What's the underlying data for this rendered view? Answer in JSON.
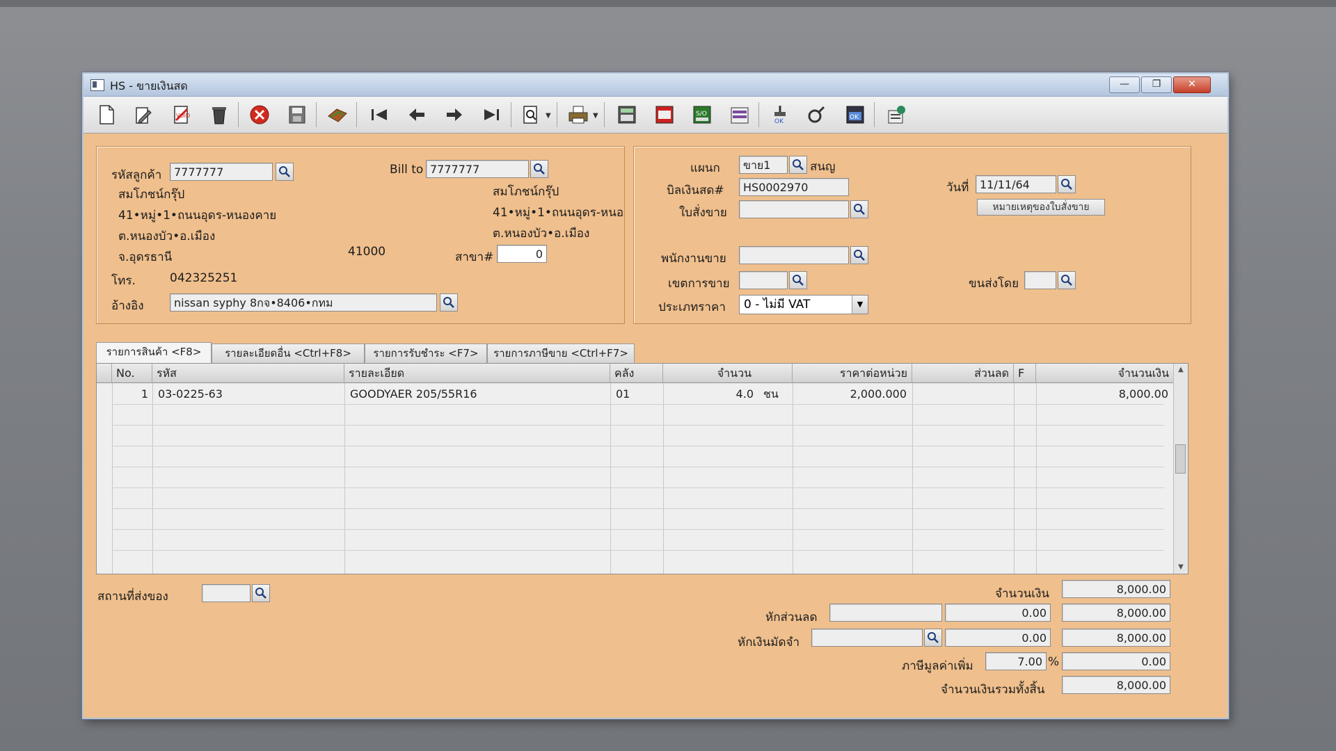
{
  "window": {
    "title": "HS - ขายเงินสด",
    "min_label": "—",
    "max_label": "❐",
    "close_label": "✕"
  },
  "toolbar": {
    "items": [
      "new-doc",
      "edit",
      "void",
      "delete",
      "cancel",
      "save",
      "copy",
      "first",
      "prev",
      "next",
      "last",
      "preview",
      "print",
      "calc-1",
      "calc-2",
      "so-yes",
      "report",
      "approve",
      "lock",
      "ok",
      "export"
    ]
  },
  "customer": {
    "code_label": "รหัสลูกค้า",
    "code_value": "7777777",
    "name": "สมโภชน์กรุ๊ป",
    "address1": "41•หมู่•1•ถนนอุดร-หนองคาย",
    "address2": "ต.หนองบัว•อ.เมือง",
    "province": "จ.อุดรธานี",
    "postcode": "41000",
    "phone_label": "โทร.",
    "phone_value": "042325251",
    "ref_label": "อ้างอิง",
    "ref_value": "nissan syphy 8กจ•8406•กทม"
  },
  "billto": {
    "label": "Bill to",
    "value": "7777777",
    "name": "สมโภชน์กรุ๊ป",
    "address1": "41•หมู่•1•ถนนอุดร-หนอ",
    "address2": "ต.หนองบัว•อ.เมือง",
    "branch_label": "สาขา#",
    "branch_value": "0"
  },
  "doc": {
    "dept_label": "แผนก",
    "dept_value": "ขาย1",
    "dept_name": "สนญ",
    "bill_label": "บิลเงินสด#",
    "bill_value": "HS0002970",
    "date_label": "วันที่",
    "date_value": "11/11/64",
    "so_label": "ใบสั่งขาย",
    "so_value": "",
    "note_button": "หมายเหตุของใบสั่งขาย",
    "sales_label": "พนักงานขาย",
    "sales_value": "",
    "area_label": "เขตการขาย",
    "area_value": "",
    "ship_by_label": "ขนส่งโดย",
    "ship_by_value": "",
    "price_type_label": "ประเภทราคา",
    "price_type_value": "0 - ไม่มี VAT"
  },
  "tabs": [
    "รายการสินค้า <F8>",
    "รายละเอียดอื่น <Ctrl+F8>",
    "รายการรับชำระ <F7>",
    "รายการภาษีขาย <Ctrl+F7>"
  ],
  "grid": {
    "headers": [
      "No.",
      "รหัส",
      "รายละเอียด",
      "คลัง",
      "จำนวน",
      "ราคาต่อหน่วย",
      "ส่วนลด",
      "F",
      "จำนวนเงิน"
    ],
    "rows": [
      {
        "no": "1",
        "code": "03-0225-63",
        "desc": "GOODYAER 205/55R16",
        "wh": "01",
        "qty": "4.0",
        "unit": "ชน",
        "price": "2,000.000",
        "disc": "",
        "f": "",
        "amount": "8,000.00"
      }
    ]
  },
  "footer": {
    "ship_place_label": "สถานที่ส่งของ",
    "ship_place_value": "",
    "amount_label": "จำนวนเงิน",
    "amount_value": "8,000.00",
    "discount_label": "หักส่วนลด",
    "discount_text": "",
    "discount_amount": "0.00",
    "discount_after": "8,000.00",
    "deposit_label": "หักเงินมัดจำ",
    "deposit_text": "",
    "deposit_amount": "0.00",
    "deposit_after": "8,000.00",
    "vat_label": "ภาษีมูลค่าเพิ่ม",
    "vat_rate": "7.00",
    "vat_pct": "%",
    "vat_value": "0.00",
    "total_label": "จำนวนเงินรวมทั้งสิ้น",
    "total_value": "8,000.00"
  }
}
